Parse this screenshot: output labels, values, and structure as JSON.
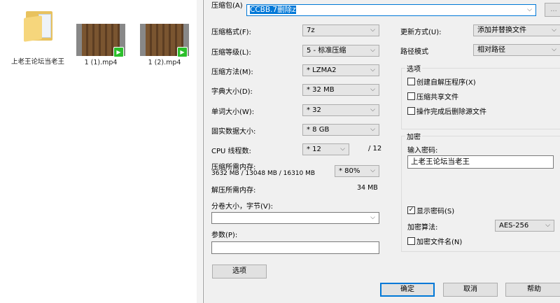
{
  "desktop": {
    "items": [
      {
        "label": "上老王论坛当老王",
        "type": "folder"
      },
      {
        "label": "1 (1).mp4",
        "type": "video"
      },
      {
        "label": "1 (2).mp4",
        "type": "video"
      }
    ]
  },
  "dialog": {
    "archive_label": "压缩包(A)",
    "archive_value": "CCBB.7删除z",
    "browse_label": "...",
    "format": {
      "label": "压缩格式(F):",
      "value": "7z"
    },
    "level": {
      "label": "压缩等级(L):",
      "value": "5 - 标准压缩"
    },
    "method": {
      "label": "压缩方法(M):",
      "value": "* LZMA2"
    },
    "dict": {
      "label": "字典大小(D):",
      "value": "* 32 MB"
    },
    "word": {
      "label": "单词大小(W):",
      "value": "* 32"
    },
    "solid": {
      "label": "固实数据大小:",
      "value": "* 8 GB"
    },
    "cpu": {
      "label": "CPU 线程数:",
      "value": "* 12",
      "max": "/ 12"
    },
    "mem": {
      "label": "压缩所需内存:",
      "detail": "3632 MB / 13048 MB / 16310 MB",
      "value": "* 80%"
    },
    "decomp": {
      "label": "解压所需内存:",
      "value": "34 MB"
    },
    "volume": {
      "label": "分卷大小，字节(V):",
      "value": ""
    },
    "params": {
      "label": "参数(P):",
      "value": ""
    },
    "update": {
      "label": "更新方式(U):",
      "value": "添加并替换文件"
    },
    "pathmode": {
      "label": "路径模式",
      "value": "相对路径"
    },
    "options": {
      "title": "选项",
      "sfx": "创建自解压程序(X)",
      "shared": "压缩共享文件",
      "delete": "操作完成后删除源文件"
    },
    "encryption": {
      "title": "加密",
      "pw_label": "输入密码:",
      "pw_value": "上老王论坛当老王",
      "show_pw": "显示密码(S)",
      "show_pw_checked": true,
      "algo_label": "加密算法:",
      "algo_value": "AES-256",
      "encrypt_names": "加密文件名(N)"
    },
    "buttons": {
      "options": "选项",
      "ok": "确定",
      "cancel": "取消",
      "help": "帮助"
    }
  }
}
